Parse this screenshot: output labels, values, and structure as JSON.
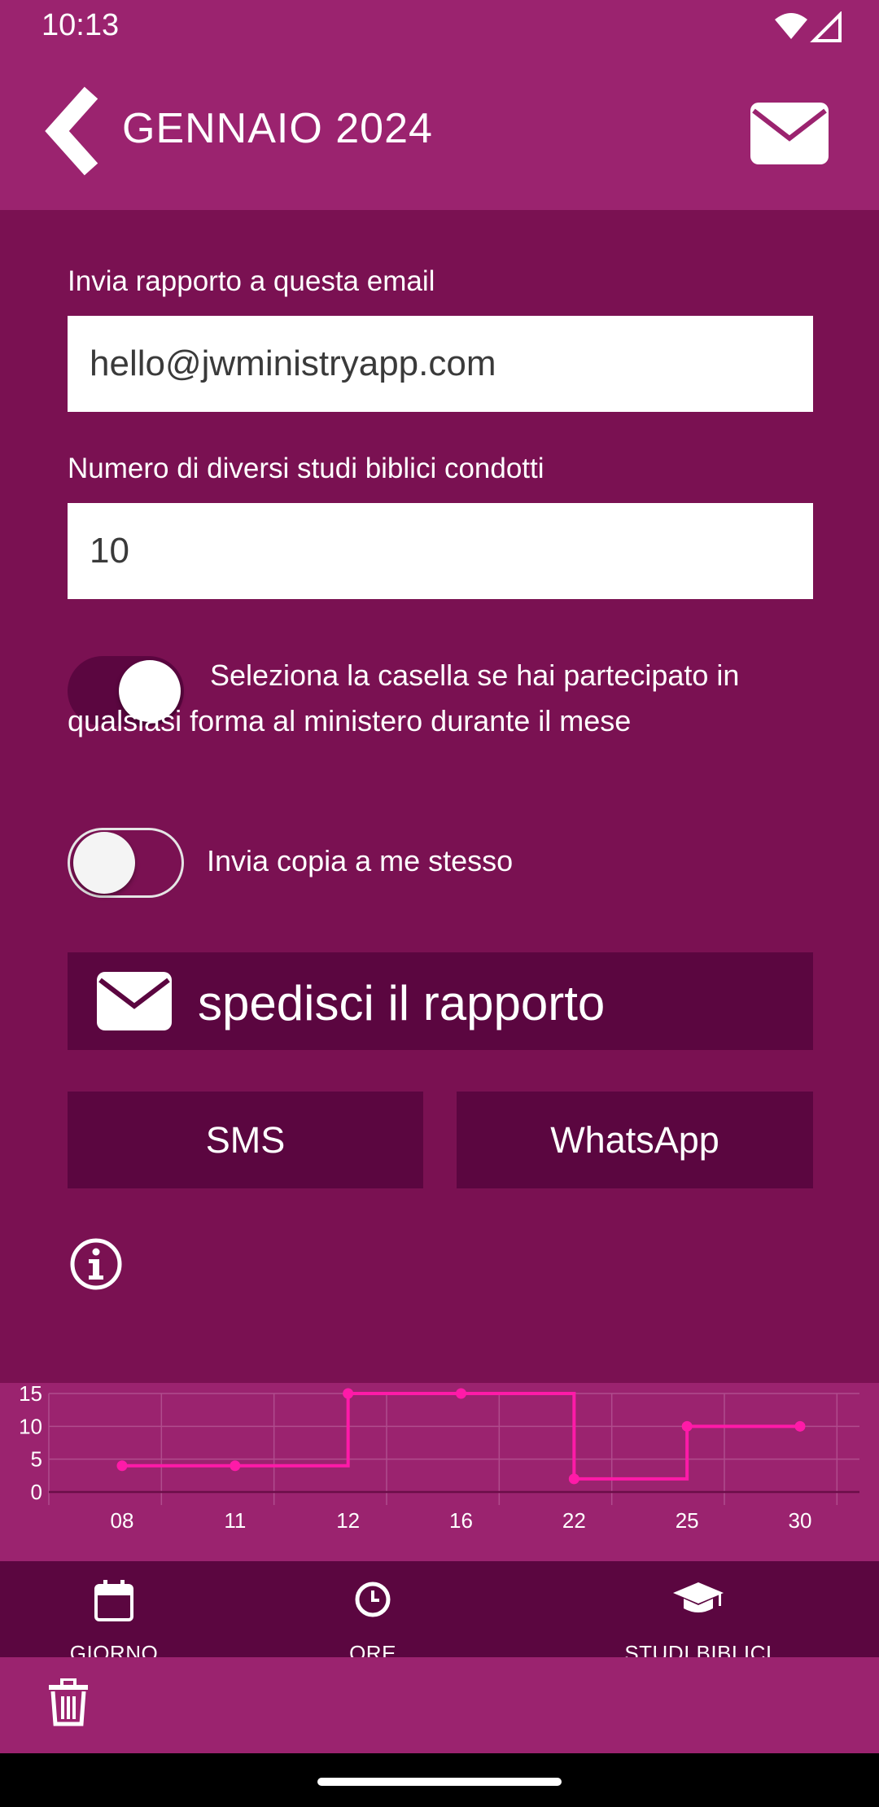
{
  "status_bar": {
    "time": "10:13"
  },
  "header": {
    "title": "GENNAIO 2024"
  },
  "form": {
    "email_label": "Invia rapporto a questa email",
    "email_value": "hello@jwministryapp.com",
    "studies_label": "Numero di diversi studi biblici condotti",
    "studies_value": "10",
    "participated_text": "Seleziona la casella se hai partecipato in qualsiasi forma al ministero durante il mese",
    "participated_on": true,
    "copy_text": "Invia copia a me stesso",
    "copy_on": false
  },
  "actions": {
    "send_label": "spedisci il rapporto",
    "sms_label": "SMS",
    "whatsapp_label": "WhatsApp"
  },
  "chart_data": {
    "type": "line",
    "step": true,
    "categories": [
      "08",
      "11",
      "12",
      "16",
      "22",
      "25",
      "30"
    ],
    "values": [
      4,
      4,
      15,
      15,
      2,
      10,
      10
    ],
    "yticks": [
      "15",
      "10",
      "5",
      "0"
    ],
    "ylim": [
      0,
      15
    ],
    "grid": true,
    "line_color": "#ff1aa8"
  },
  "bottom_nav": {
    "items": [
      {
        "label": "GIORNO",
        "icon": "calendar-icon"
      },
      {
        "label": "ORE",
        "icon": "clock-icon"
      },
      {
        "label": "STUDI BIBLICI",
        "icon": "graduation-cap-icon"
      }
    ]
  },
  "colors": {
    "background": "#7a1152",
    "header": "#9b236f",
    "button": "#5b0640"
  }
}
